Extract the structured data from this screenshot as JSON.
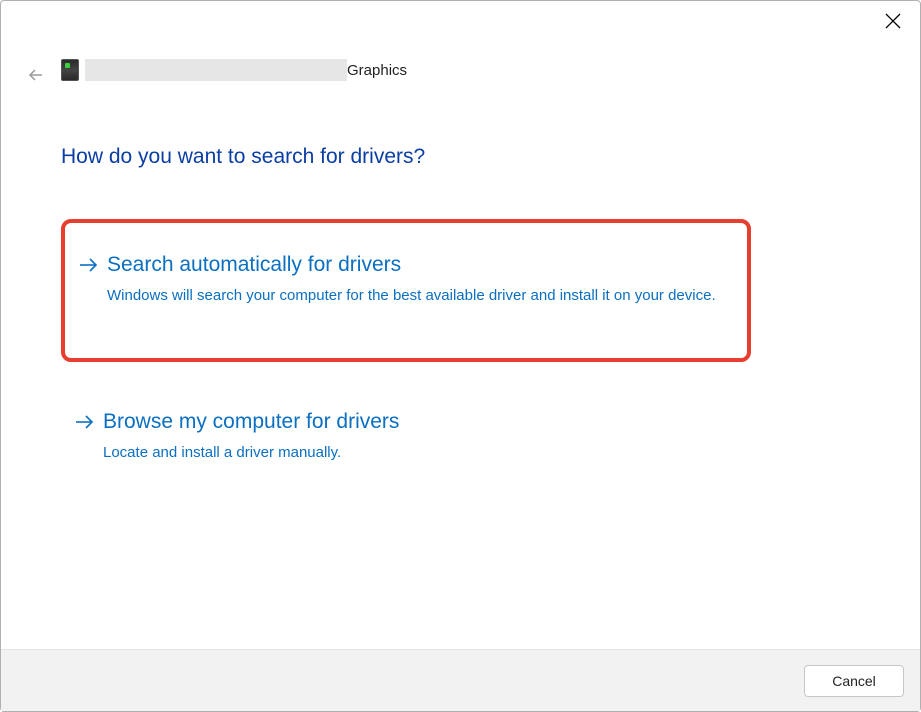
{
  "device": {
    "suffix": "Graphics"
  },
  "heading": "How do you want to search for drivers?",
  "options": [
    {
      "title": "Search automatically for drivers",
      "desc": "Windows will search your computer for the best available driver and install it on your device.",
      "highlighted": true
    },
    {
      "title": "Browse my computer for drivers",
      "desc": "Locate and install a driver manually.",
      "highlighted": false
    }
  ],
  "buttons": {
    "cancel": "Cancel"
  }
}
